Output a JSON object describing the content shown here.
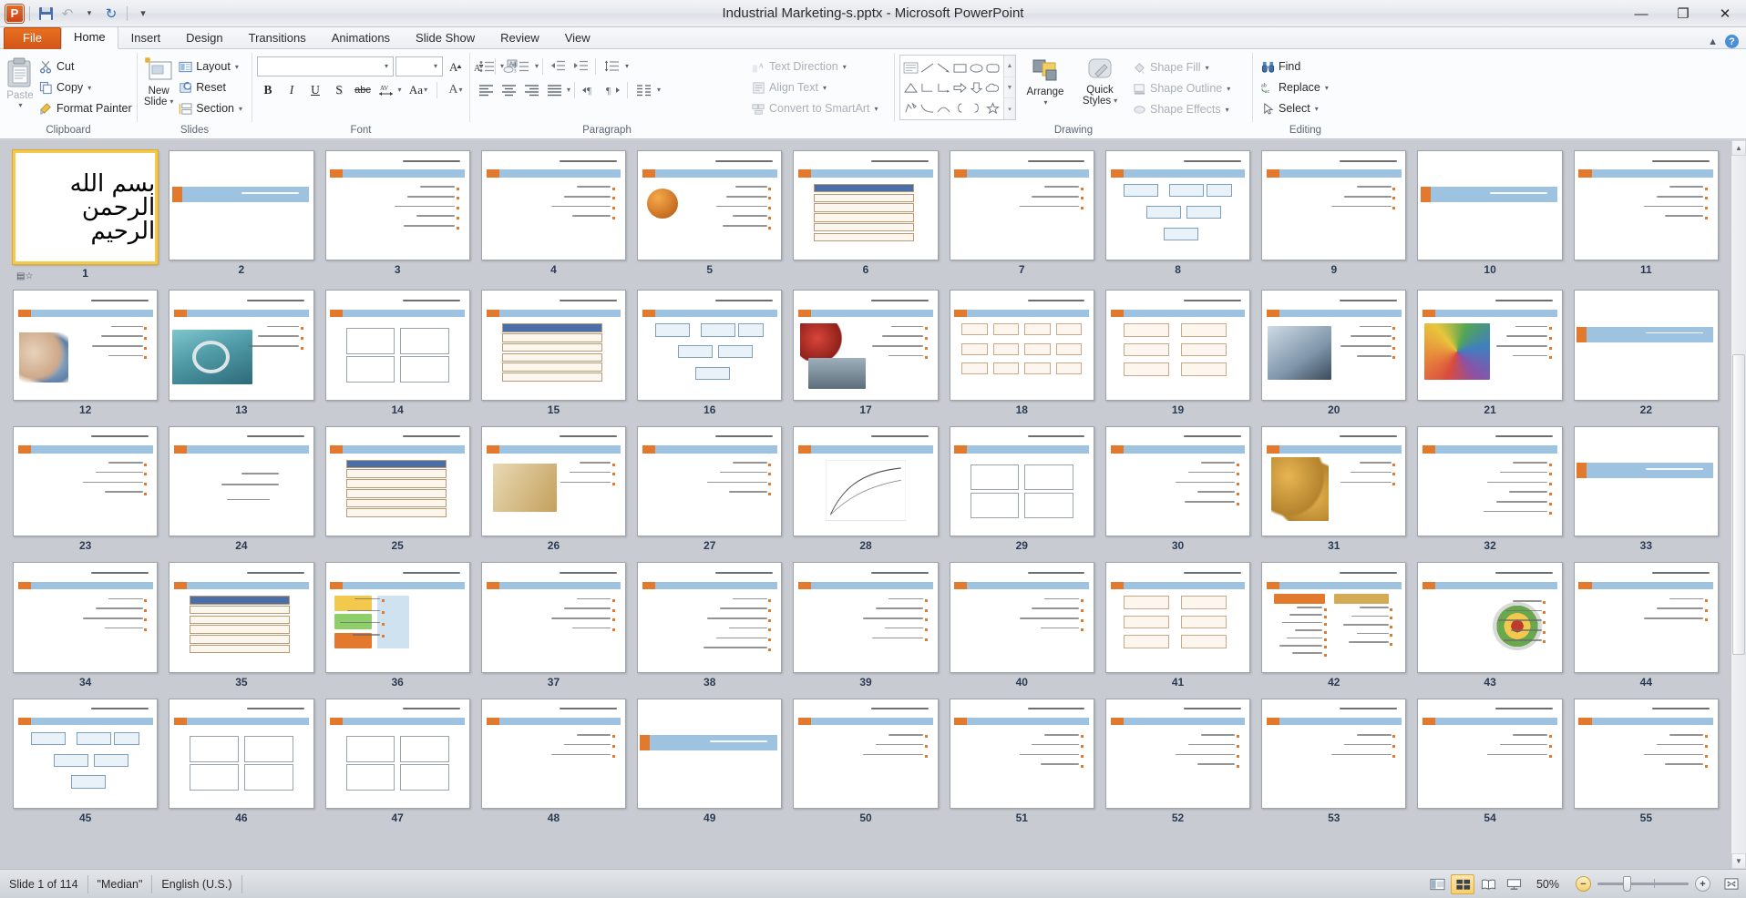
{
  "window": {
    "title": "Industrial Marketing-s.pptx  -  Microsoft PowerPoint",
    "minimize": "—",
    "restore": "❐",
    "close": "✕"
  },
  "quick_access": {
    "app_logo": "P",
    "save": "save-icon",
    "undo": "undo-icon",
    "undo_more": "▾",
    "redo": "redo-icon",
    "customize": "▾"
  },
  "tabs": [
    {
      "label": "File",
      "type": "file"
    },
    {
      "label": "Home",
      "active": true
    },
    {
      "label": "Insert"
    },
    {
      "label": "Design"
    },
    {
      "label": "Transitions"
    },
    {
      "label": "Animations"
    },
    {
      "label": "Slide Show"
    },
    {
      "label": "Review"
    },
    {
      "label": "View"
    }
  ],
  "tab_right": {
    "minimize_ribbon": "▲",
    "help": "?"
  },
  "ribbon": {
    "groups": [
      {
        "name": "Clipboard",
        "label": "Clipboard",
        "paste": "Paste",
        "items": [
          {
            "label": "Cut",
            "icon": "scissors-icon"
          },
          {
            "label": "Copy",
            "icon": "copy-icon",
            "caret": "▾"
          },
          {
            "label": "Format Painter",
            "icon": "paintbrush-icon"
          }
        ]
      },
      {
        "name": "Slides",
        "label": "Slides",
        "new_slide": "New\nSlide",
        "new_slide_line1": "New",
        "new_slide_line2": "Slide",
        "items": [
          {
            "label": "Layout",
            "icon": "layout-icon",
            "caret": "▾"
          },
          {
            "label": "Reset",
            "icon": "reset-icon"
          },
          {
            "label": "Section",
            "icon": "section-icon",
            "caret": "▾"
          }
        ]
      },
      {
        "name": "Font",
        "label": "Font",
        "font_name_value": "",
        "font_size_value": "",
        "grow_font": "A",
        "shrink_font": "A",
        "clear_formatting": "Aa",
        "bold": "B",
        "italic": "I",
        "underline": "U",
        "shadow": "S",
        "strikethrough": "abc",
        "character_spacing": "AV",
        "change_case": "Aa",
        "font_color": "A"
      },
      {
        "name": "Paragraph",
        "label": "Paragraph",
        "bullets": "bullets-icon",
        "numbering": "numbering-icon",
        "decrease_indent": "decrease-indent-icon",
        "increase_indent": "increase-indent-icon",
        "line_spacing": "line-spacing-icon",
        "align_left": "align-left-icon",
        "align_center": "align-center-icon",
        "align_right": "align-right-icon",
        "justify": "justify-icon",
        "ltr": "ltr-icon",
        "rtl": "rtl-icon",
        "columns": "columns-icon",
        "text_direction": "Text Direction",
        "align_text": "Align Text",
        "convert_to_smartart": "Convert to SmartArt"
      },
      {
        "name": "Drawing",
        "label": "Drawing",
        "arrange": "Arrange",
        "quick_styles_line1": "Quick",
        "quick_styles_line2": "Styles",
        "shape_fill": "Shape Fill",
        "shape_outline": "Shape Outline",
        "shape_effects": "Shape Effects"
      },
      {
        "name": "Editing",
        "label": "Editing",
        "find": "Find",
        "replace": "Replace",
        "select": "Select"
      }
    ]
  },
  "status": {
    "slide_counter": "Slide 1 of 114",
    "theme": "\"Median\"",
    "language": "English (U.S.)",
    "zoom_level": "50%",
    "views": [
      {
        "name": "normal-view",
        "label": "normal",
        "active": false
      },
      {
        "name": "slide-sorter-view",
        "label": "sorter",
        "active": true
      },
      {
        "name": "reading-view",
        "label": "reading",
        "active": false
      },
      {
        "name": "slide-show-view",
        "label": "show",
        "active": false
      }
    ],
    "zoom_out": "−",
    "zoom_in": "+",
    "fit_to_window": "fit-icon"
  },
  "sorter": {
    "selected_slide": 1,
    "total_slides": 114,
    "visible_first": 1,
    "visible_last": 55,
    "columns": 11,
    "colors": {
      "accent_orange": "#e3792c",
      "accent_blue": "#9dc3e0",
      "selection": "#f2c94c",
      "background": "#c8ccd2",
      "gold": "#d4ab54"
    },
    "slides": [
      {
        "n": 1,
        "kind": "bismillah",
        "text": "بسم الله الرحمن الرحیم"
      },
      {
        "n": 2,
        "kind": "section",
        "title": "بازاریابی صنعتی"
      },
      {
        "n": 3,
        "kind": "bullets",
        "title": "فصل اول ـ گستره بازاریابی صنعتی",
        "bullets": 5
      },
      {
        "n": 4,
        "kind": "bullets",
        "title": "مقدمه",
        "bullets": 4
      },
      {
        "n": 5,
        "kind": "picture-bullets",
        "title": "ویژگی بازارهای صنعتی",
        "bullets": 5,
        "art": "sphere"
      },
      {
        "n": 6,
        "kind": "table",
        "title": "ماهیت تکمیلی و دوگانگی صنعتی"
      },
      {
        "n": 7,
        "kind": "bullets",
        "title": "طبقه‌بندی مشتریان صنعتی",
        "bullets": 3
      },
      {
        "n": 8,
        "kind": "diagram",
        "title": "طبقه‌بندی محصولات در بازارهای صنعتی"
      },
      {
        "n": 9,
        "kind": "bullets",
        "title": "بودجه‌بندی خرید در بازارهای صنعتی",
        "bullets": 3
      },
      {
        "n": 10,
        "kind": "section",
        "title": "فصل دوم: رفتار خرید مشتریان در بازارهای صنعتی"
      },
      {
        "n": 11,
        "kind": "bullets",
        "title": "اهداف فصل",
        "bullets": 4
      },
      {
        "n": 12,
        "kind": "picture-bullets",
        "title": "واحد تصمیم‌گیری سازمانی",
        "bullets": 4,
        "art": "people"
      },
      {
        "n": 13,
        "kind": "picture-bullets",
        "title": "موقعیت‌های خرید صنعتی",
        "bullets": 3,
        "art": "machine"
      },
      {
        "n": 14,
        "kind": "quad",
        "title": "استراتژی‌های خرید"
      },
      {
        "n": 15,
        "kind": "table",
        "title": "تفاوت تأمین‌کننده"
      },
      {
        "n": 16,
        "kind": "diagram",
        "title": "گام‌های فرایند تصمیم‌گیری"
      },
      {
        "n": 17,
        "kind": "picture-bullets",
        "title": "مدل‌های رفتار خریداران سازمانی",
        "bullets": 4,
        "art": "cart"
      },
      {
        "n": 18,
        "kind": "bigdiagram",
        "title": "مدل رفتار خرید سازمانی"
      },
      {
        "n": 19,
        "kind": "flow",
        "title": "مراحل فرآیند خرید"
      },
      {
        "n": 20,
        "kind": "picture-bullets",
        "title": "",
        "bullets": 4,
        "art": "handshake"
      },
      {
        "n": 21,
        "kind": "picture-bullets",
        "title": "",
        "bullets": 4,
        "art": "pens"
      },
      {
        "n": 22,
        "kind": "section",
        "title": "فصل سوم: تحقیقات بازاریابی در بازارهای صنعتی"
      },
      {
        "n": 23,
        "kind": "bullets",
        "title": "اهداف فصل",
        "bullets": 4
      },
      {
        "n": 24,
        "kind": "sparse",
        "title": "انواع اطلاعات در بازارهای صنعتی"
      },
      {
        "n": 25,
        "kind": "table",
        "title": "جدول"
      },
      {
        "n": 26,
        "kind": "picture-bullets",
        "title": "چرخه‌های مبادله در رابطه صنعتی و همکاری",
        "bullets": 3,
        "art": "locking"
      },
      {
        "n": 27,
        "kind": "bullets",
        "title": "اندازه‌گیری سودآوری مشتریان",
        "bullets": 4
      },
      {
        "n": 28,
        "kind": "chart",
        "title": "نمودار تحلیل سودآوری مشتریان"
      },
      {
        "n": 29,
        "kind": "quad",
        "title": "وفا، تقسیم‌بندی سودآوری مشتریان"
      },
      {
        "n": 30,
        "kind": "bullets",
        "title": "وضعیت مشتریان پایدار",
        "bullets": 5
      },
      {
        "n": 31,
        "kind": "picture-bullets",
        "title": "شبکه‌ای نقش در تمام موجودیت‌ شناختی",
        "bullets": 3,
        "art": "figures"
      },
      {
        "n": 32,
        "kind": "bullets",
        "title": "آمده‌های استراتژیک",
        "bullets": 6
      },
      {
        "n": 33,
        "kind": "section",
        "title": "فصل چهارم: شناسایی جایگاه و زنجیره ارزش"
      },
      {
        "n": 34,
        "kind": "bullets",
        "title": "اهداف فصل",
        "bullets": 4
      },
      {
        "n": 35,
        "kind": "table",
        "title": "مدلی از بخش‌بندی HP"
      },
      {
        "n": 36,
        "kind": "colorchart",
        "title": "مراحل بخش‌بندی"
      },
      {
        "n": 37,
        "kind": "bullets",
        "title": "معیارهای بخش‌بندی",
        "bullets": 4
      },
      {
        "n": 38,
        "kind": "bullets",
        "title": "معیارهای بخش‌بندی",
        "bullets": 6
      },
      {
        "n": 39,
        "kind": "bullets",
        "title": "ادامه",
        "bullets": 5
      },
      {
        "n": 40,
        "kind": "bullets",
        "title": "ویژگی‌های بخش‌بندی",
        "bullets": 4
      },
      {
        "n": 41,
        "kind": "flow",
        "title": "بخش‌بندی دو مرحله‌ای"
      },
      {
        "n": 42,
        "kind": "twocol",
        "title": "ادامه ...."
      },
      {
        "n": 43,
        "kind": "target",
        "title": "چگونگی آماج‌یابی"
      },
      {
        "n": 44,
        "kind": "bullets",
        "title": "آماج‌یابی بازار عمومی",
        "bullets": 3
      },
      {
        "n": 45,
        "kind": "diagram",
        "title": "موقعیت‌یابی"
      },
      {
        "n": 46,
        "kind": "quad",
        "title": "ادامه"
      },
      {
        "n": 47,
        "kind": "quad",
        "title": "موقعیت‌یابی"
      },
      {
        "n": 48,
        "kind": "bullets",
        "title": "بخش‌بندی چهار بعدی",
        "bullets": 3
      },
      {
        "n": 49,
        "kind": "section",
        "title": "فصل پنجم: برنامه‌ریزی استراتژیک"
      },
      {
        "n": 50,
        "kind": "bullets",
        "title": "اهداف فصل",
        "bullets": 3
      },
      {
        "n": 51,
        "kind": "bullets",
        "title": "سطرح",
        "bullets": 4
      },
      {
        "n": 52,
        "kind": "bullets",
        "title": "تعریف استراتژی",
        "bullets": 4
      },
      {
        "n": 53,
        "kind": "bullets",
        "title": "نقش بازاریابی در استراتژی",
        "bullets": 3
      },
      {
        "n": 54,
        "kind": "bullets",
        "title": "استراتژی بازاریابی",
        "bullets": 3
      },
      {
        "n": 55,
        "kind": "bullets",
        "title": "تحلیل استراتژیک",
        "bullets": 4
      }
    ]
  }
}
